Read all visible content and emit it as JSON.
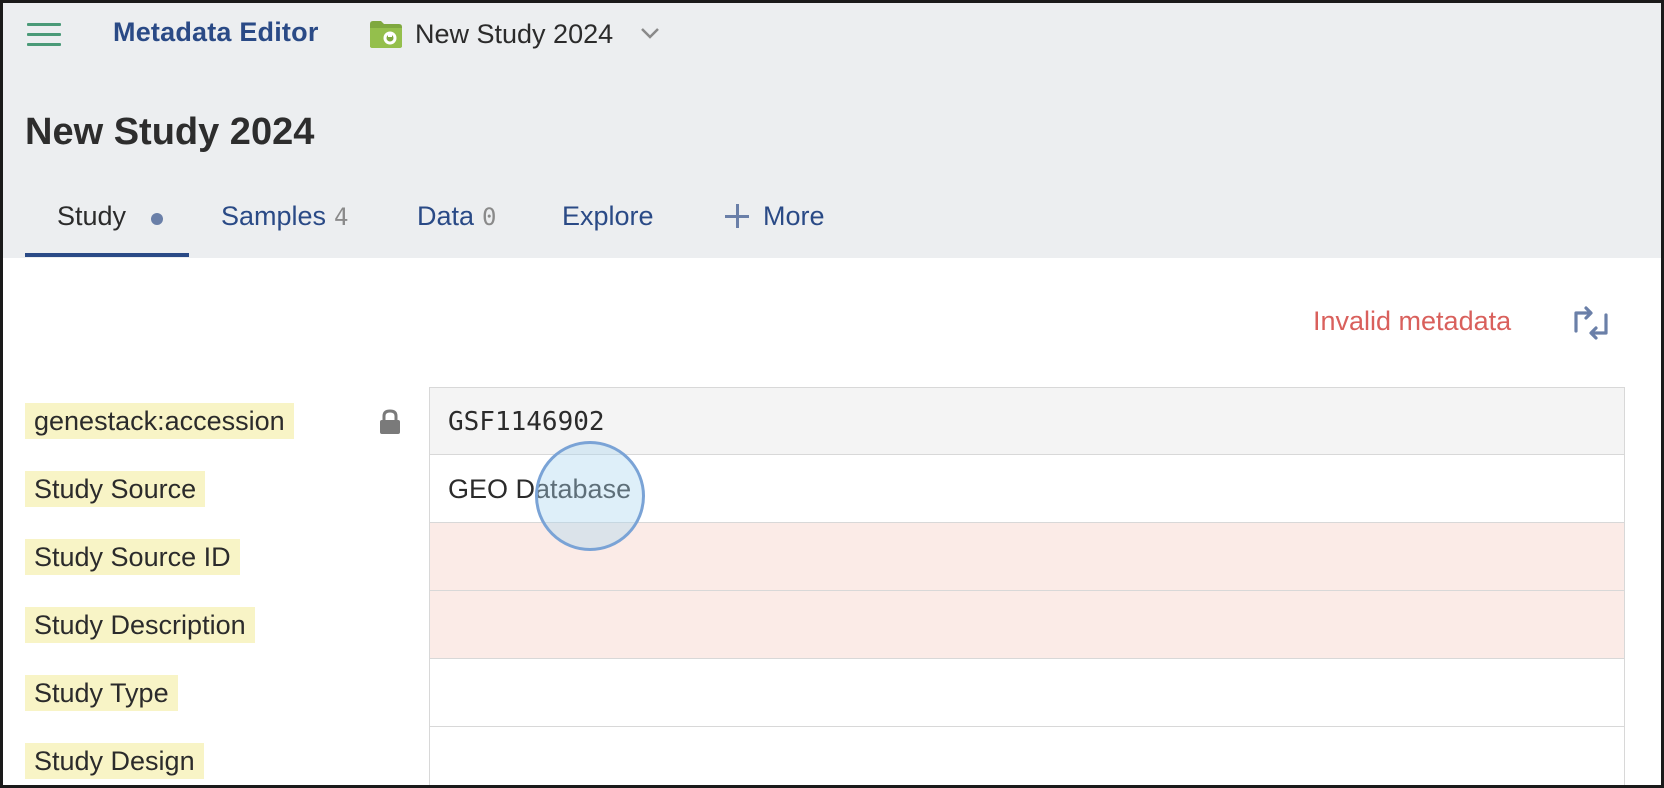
{
  "header": {
    "app_title": "Metadata Editor",
    "study_name": "New Study 2024",
    "icons": {
      "menu": "hamburger-menu-icon",
      "folder": "study-folder-icon",
      "dropdown": "chevron-down-icon"
    }
  },
  "page": {
    "title": "New Study 2024"
  },
  "tabs": [
    {
      "label": "Study",
      "selected": true,
      "indicator": "unsaved-dot"
    },
    {
      "label": "Samples",
      "count": "4"
    },
    {
      "label": "Data",
      "count": "0"
    },
    {
      "label": "Explore"
    },
    {
      "label": "More",
      "icon": "plus-icon"
    }
  ],
  "status": {
    "text": "Invalid metadata",
    "color": "#d9605c",
    "sync_icon": "sync-arrows-icon"
  },
  "fields": [
    {
      "label": "genestack:accession",
      "value": "GSF1146902",
      "locked": true,
      "invalid": false
    },
    {
      "label": "Study Source",
      "value": "GEO Database",
      "locked": false,
      "invalid": false
    },
    {
      "label": "Study Source ID",
      "value": "",
      "locked": false,
      "invalid": true
    },
    {
      "label": "Study Description",
      "value": "",
      "locked": false,
      "invalid": true
    },
    {
      "label": "Study Type",
      "value": "",
      "locked": false,
      "invalid": false
    },
    {
      "label": "Study Design",
      "value": "",
      "locked": false,
      "invalid": false
    }
  ],
  "colors": {
    "accent": "#2a4a86",
    "label_highlight": "#f8f4c6",
    "invalid_bg": "#fbebe7",
    "menu_icon": "#4a9a78"
  }
}
